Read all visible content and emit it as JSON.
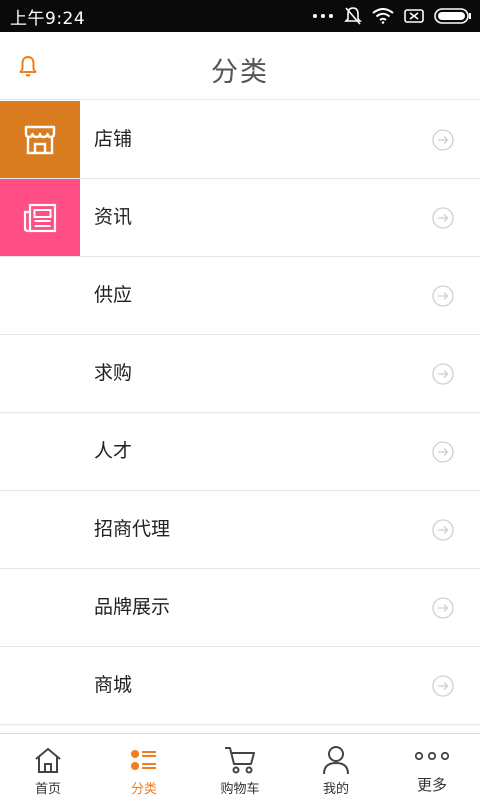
{
  "status_bar": {
    "time": "上午9:24"
  },
  "header": {
    "title": "分类"
  },
  "categories": [
    {
      "label": "店铺"
    },
    {
      "label": "资讯"
    },
    {
      "label": "供应"
    },
    {
      "label": "求购"
    },
    {
      "label": "人才"
    },
    {
      "label": "招商代理"
    },
    {
      "label": "品牌展示"
    },
    {
      "label": "商城"
    }
  ],
  "tiles": {
    "store": {
      "icon": "storefront-icon",
      "color": "#d97d20"
    },
    "news": {
      "icon": "newspaper-icon",
      "color": "#ff4f86"
    }
  },
  "nav": [
    {
      "label": "首页",
      "icon": "home-icon"
    },
    {
      "label": "分类",
      "icon": "category-icon",
      "active": true
    },
    {
      "label": "购物车",
      "icon": "cart-icon"
    },
    {
      "label": "我的",
      "icon": "user-icon"
    },
    {
      "label": "更多",
      "icon": "more-icon"
    }
  ],
  "colors": {
    "accent": "#f07d1e",
    "status_bar": "#0a0a0a"
  }
}
